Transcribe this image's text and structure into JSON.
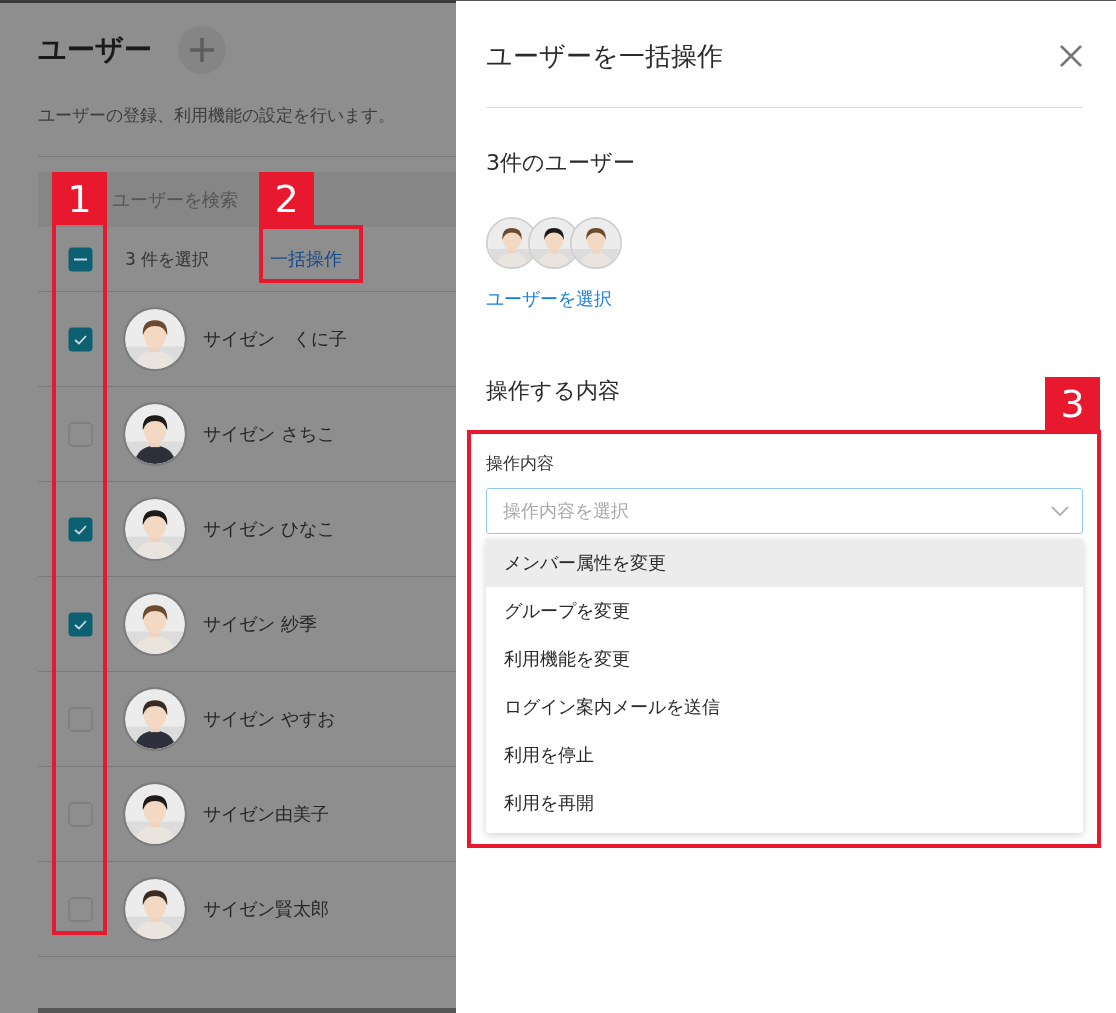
{
  "page": {
    "title": "ユーザー",
    "description": "ユーザーの登録、利用機能の設定を行います。"
  },
  "search": {
    "placeholder": "ユーザーを検索"
  },
  "list_header": {
    "indeterminate": true,
    "count": "3 件を選択",
    "bulk_link": "一括操作"
  },
  "users": [
    {
      "name": "サイゼン　くに子",
      "checked": true
    },
    {
      "name": "サイゼン さちこ",
      "checked": false
    },
    {
      "name": "サイゼン ひなこ",
      "checked": true
    },
    {
      "name": "サイゼン 紗季",
      "checked": true
    },
    {
      "name": "サイゼン やすお",
      "checked": false
    },
    {
      "name": "サイゼン由美子",
      "checked": false
    },
    {
      "name": "サイゼン賢太郎",
      "checked": false
    }
  ],
  "panel": {
    "title": "ユーザーを一括操作",
    "users_heading": "3件のユーザー",
    "select_users_link": "ユーザーを選択",
    "section_heading": "操作する内容",
    "field": {
      "label": "操作内容",
      "placeholder": "操作内容を選択"
    },
    "options": [
      {
        "label": "メンバー属性を変更",
        "selected": true
      },
      {
        "label": "グループを変更",
        "selected": false
      },
      {
        "label": "利用機能を変更",
        "selected": false
      },
      {
        "label": "ログイン案内メールを送信",
        "selected": false
      },
      {
        "label": "利用を停止",
        "selected": false
      },
      {
        "label": "利用を再開",
        "selected": false
      }
    ]
  },
  "annotations": [
    {
      "label": "1"
    },
    {
      "label": "2"
    },
    {
      "label": "3"
    }
  ]
}
